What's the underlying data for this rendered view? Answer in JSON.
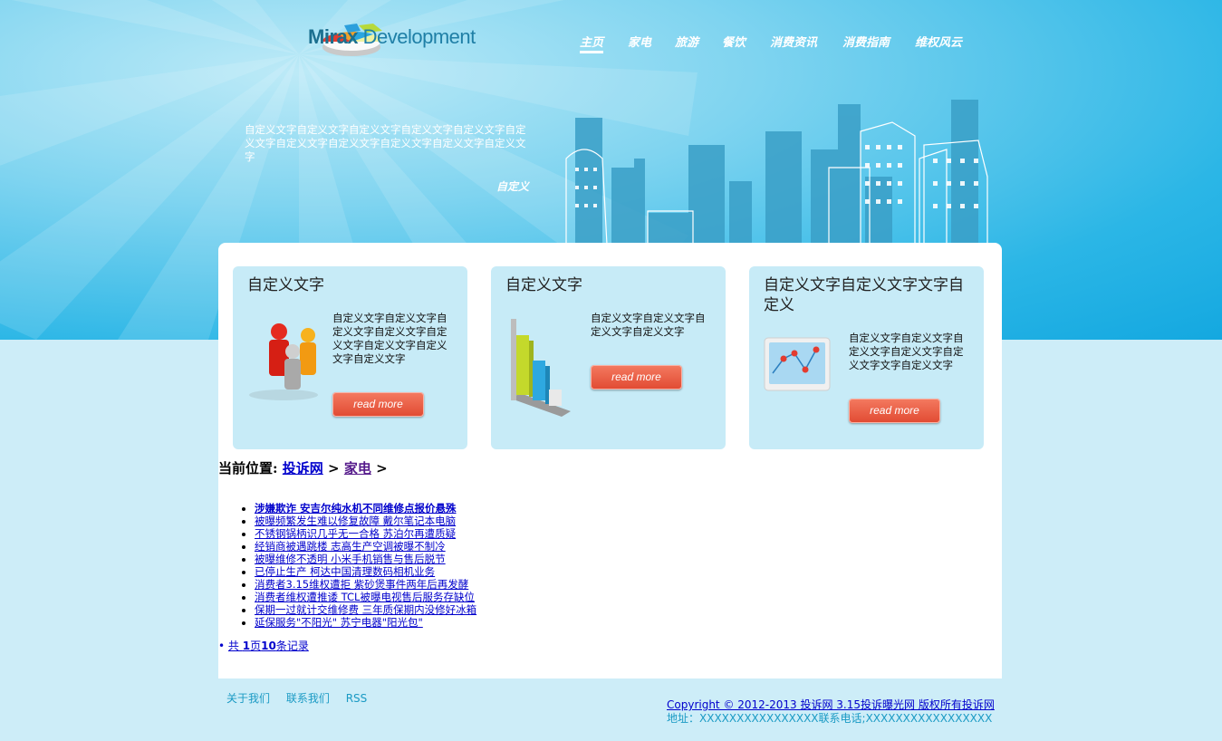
{
  "brand": {
    "logo_bold": "Mirax",
    "logo_light": "Development"
  },
  "nav": [
    {
      "label": "主页",
      "active": true
    },
    {
      "label": "家电",
      "active": false
    },
    {
      "label": "旅游",
      "active": false
    },
    {
      "label": "餐饮",
      "active": false
    },
    {
      "label": "消费资讯",
      "active": false
    },
    {
      "label": "消费指南",
      "active": false
    },
    {
      "label": "维权风云",
      "active": false
    }
  ],
  "hero": {
    "text": "自定义文字自定义文字自定义文字自定义文字自定义文字自定义文字自定义文字自定义文字自定义文字自定义文字自定义文字",
    "more": "自定义"
  },
  "cards": [
    {
      "title": "自定义文字",
      "text": "自定义文字自定义文字自定义文字自定义文字自定义文字自定义文字自定义文字自定义文字",
      "button": "read more",
      "icon": "people-icon"
    },
    {
      "title": "自定义文字",
      "text": "自定义文字自定义文字自定义文字自定义文字",
      "button": "read more",
      "icon": "bar-chart-icon"
    },
    {
      "title": "自定义文字自定义文字文字自定义",
      "text": "自定义文字自定义文字自定义文字自定义文字自定义文字文字自定义文字",
      "button": "read more",
      "icon": "line-chart-screen-icon"
    }
  ],
  "breadcrumb": {
    "prefix": "当前位置:",
    "home": "投诉网",
    "sep": ">",
    "current": "家电",
    "tail": ">"
  },
  "articles": [
    "涉嫌欺诈 安吉尔纯水机不同维修点报价悬殊",
    "被曝频繁发生难以修复故障 戴尔笔记本电脑",
    "不锈钢锅柄识几乎无一合格 苏泊尔再遭质疑",
    "经销商被遇跳楼 志高生产空调被曝不制冷",
    "被曝维修不透明 小米手机销售与售后脱节",
    "已停止生产 柯达中国清理数码相机业务",
    "消费者3.15维权遭拒 紫砂煲事件两年后再发酵",
    "消费者维权遭推诿 TCL被曝电视售后服务存缺位",
    "保期一过就计交维修费 三年质保期内没修好冰箱",
    "延保服务\"不阳光\" 苏宁电器\"阳光包\""
  ],
  "pager": {
    "prefix": "共 ",
    "pages": "1",
    "mid": "页",
    "records": "10",
    "suffix": "条记录"
  },
  "footer": {
    "links": [
      "关于我们",
      "联系我们",
      "RSS"
    ],
    "copyright": "Copyright © 2012-2013 投诉网 3.15投诉曝光网 版权所有投诉网",
    "address": "地址：XXXXXXXXXXXXXXXX联系电话;XXXXXXXXXXXXXXXXX"
  }
}
